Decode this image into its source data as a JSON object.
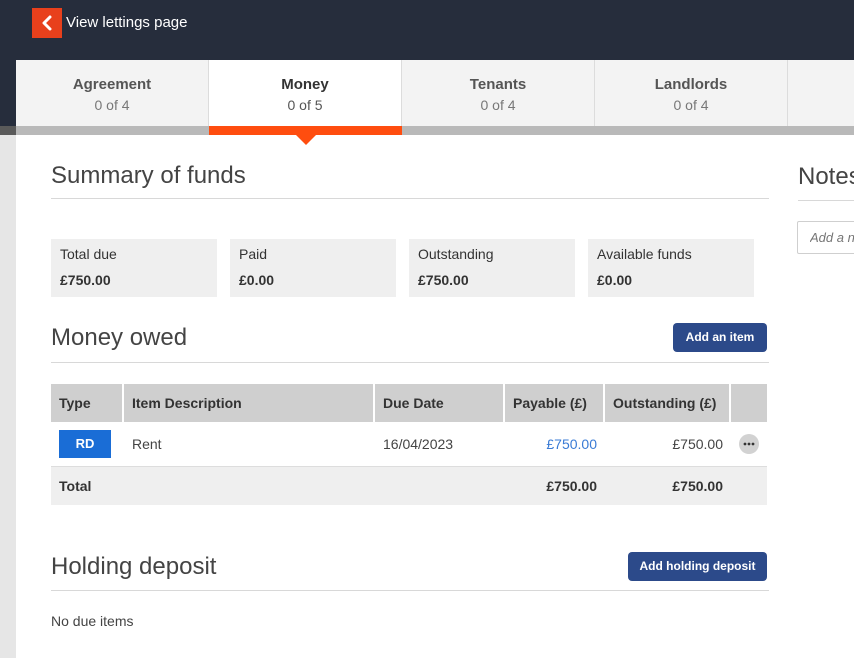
{
  "header": {
    "back_label": "View lettings page"
  },
  "tabs": [
    {
      "title": "Agreement",
      "count": "0 of 4"
    },
    {
      "title": "Money",
      "count": "0 of 5"
    },
    {
      "title": "Tenants",
      "count": "0 of 4"
    },
    {
      "title": "Landlords",
      "count": "0 of 4"
    }
  ],
  "summary": {
    "title": "Summary of funds",
    "boxes": [
      {
        "label": "Total due",
        "value": "£750.00"
      },
      {
        "label": "Paid",
        "value": "£0.00"
      },
      {
        "label": "Outstanding",
        "value": "£750.00"
      },
      {
        "label": "Available funds",
        "value": "£0.00"
      }
    ]
  },
  "money_owed": {
    "title": "Money owed",
    "add_button": "Add an item",
    "columns": [
      "Type",
      "Item Description",
      "Due Date",
      "Payable (£)",
      "Outstanding (£)"
    ],
    "rows": [
      {
        "type": "RD",
        "description": "Rent",
        "due_date": "16/04/2023",
        "payable": "£750.00",
        "outstanding": "£750.00"
      }
    ],
    "total": {
      "label": "Total",
      "payable": "£750.00",
      "outstanding": "£750.00"
    }
  },
  "holding_deposit": {
    "title": "Holding deposit",
    "add_button": "Add holding deposit",
    "empty_text": "No due items"
  },
  "notes": {
    "title": "Notes",
    "placeholder": "Add a n"
  },
  "colors": {
    "topbar": "#262d3c",
    "accent": "#ff4d0f",
    "back_button": "#e8401c",
    "primary_button": "#2c4a8a",
    "badge": "#1a6dd6",
    "link": "#3a7bd5"
  }
}
